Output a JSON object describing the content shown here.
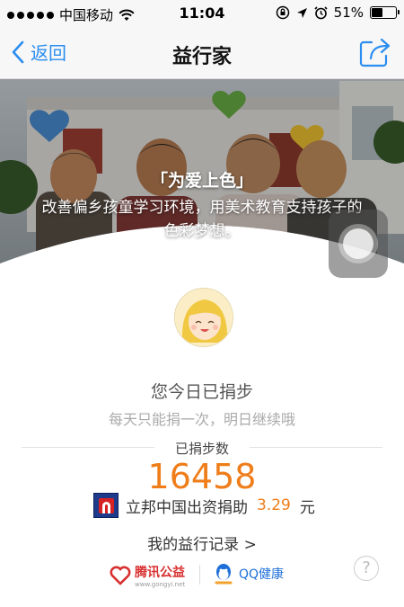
{
  "status_bar": {
    "carrier": "中国移动",
    "time": "11:04",
    "battery": "51%",
    "battery_level": 0.51
  },
  "nav": {
    "back_label": "返回",
    "title": "益行家"
  },
  "hero": {
    "title": "「为爱上色」",
    "description": "改善偏乡孩童学习环境，用美术教育支持孩子的色彩梦想。"
  },
  "profile": {
    "donated_text": "您今日已捐步",
    "hint_text": "每天只能捐一次，明日继续哦"
  },
  "steps": {
    "label": "已捐步数",
    "value": "16458"
  },
  "sponsor": {
    "text": "立邦中国出资捐助",
    "amount": "3.29",
    "unit": "元"
  },
  "record": {
    "label": "我的益行记录 >"
  },
  "footer": {
    "tencent_label": "腾讯公益",
    "tencent_url": "www.gongyi.net",
    "qq_health_label": "QQ健康",
    "help_label": "?"
  },
  "colors": {
    "accent": "#2a8df0",
    "orange": "#ef7d1a"
  }
}
